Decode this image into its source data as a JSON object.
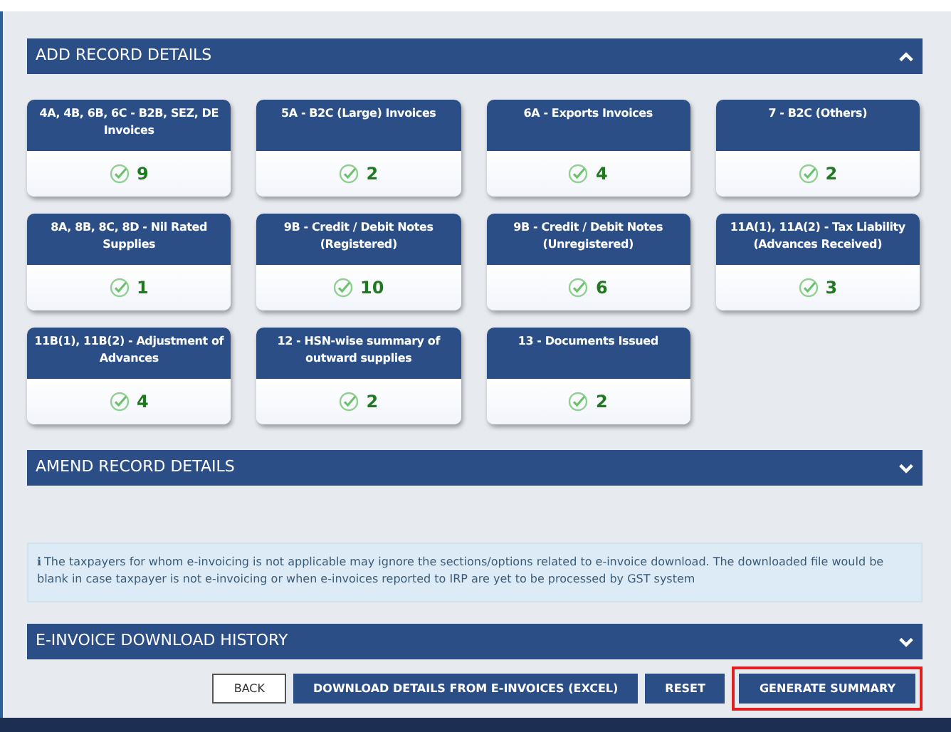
{
  "sections": [
    {
      "title": "ADD RECORD DETAILS",
      "expanded": true,
      "cards": [
        {
          "title": "4A, 4B, 6B, 6C - B2B, SEZ, DE Invoices",
          "count": "9"
        },
        {
          "title": "5A - B2C (Large) Invoices",
          "count": "2"
        },
        {
          "title": "6A - Exports Invoices",
          "count": "4"
        },
        {
          "title": "7 - B2C (Others)",
          "count": "2"
        },
        {
          "title": "8A, 8B, 8C, 8D - Nil Rated Supplies",
          "count": "1"
        },
        {
          "title": "9B - Credit / Debit Notes (Registered)",
          "count": "10"
        },
        {
          "title": "9B - Credit / Debit Notes (Unregistered)",
          "count": "6"
        },
        {
          "title": "11A(1), 11A(2) - Tax Liability (Advances Received)",
          "count": "3"
        },
        {
          "title": "11B(1), 11B(2) - Adjustment of Advances",
          "count": "4"
        },
        {
          "title": "12 - HSN-wise summary of outward supplies",
          "count": "2"
        },
        {
          "title": "13 - Documents Issued",
          "count": "2"
        }
      ]
    },
    {
      "title": "AMEND RECORD DETAILS",
      "expanded": false
    }
  ],
  "info": {
    "icon": "ℹ",
    "text": "The taxpayers for whom e-invoicing is not applicable may ignore the sections/options related to e-invoice download. The downloaded file would be blank in case taxpayer is not e-invoicing or when e-invoices reported to IRP are yet to be processed by GST system"
  },
  "history": {
    "title": "E-INVOICE DOWNLOAD HISTORY",
    "expanded": false
  },
  "buttons": [
    {
      "label": "BACK",
      "kind": "outline",
      "highlighted": false
    },
    {
      "label": "DOWNLOAD DETAILS FROM E-INVOICES (EXCEL)",
      "kind": "primary",
      "highlighted": false
    },
    {
      "label": "RESET",
      "kind": "primary",
      "highlighted": false
    },
    {
      "label": "GENERATE SUMMARY",
      "kind": "primary",
      "highlighted": true
    }
  ]
}
